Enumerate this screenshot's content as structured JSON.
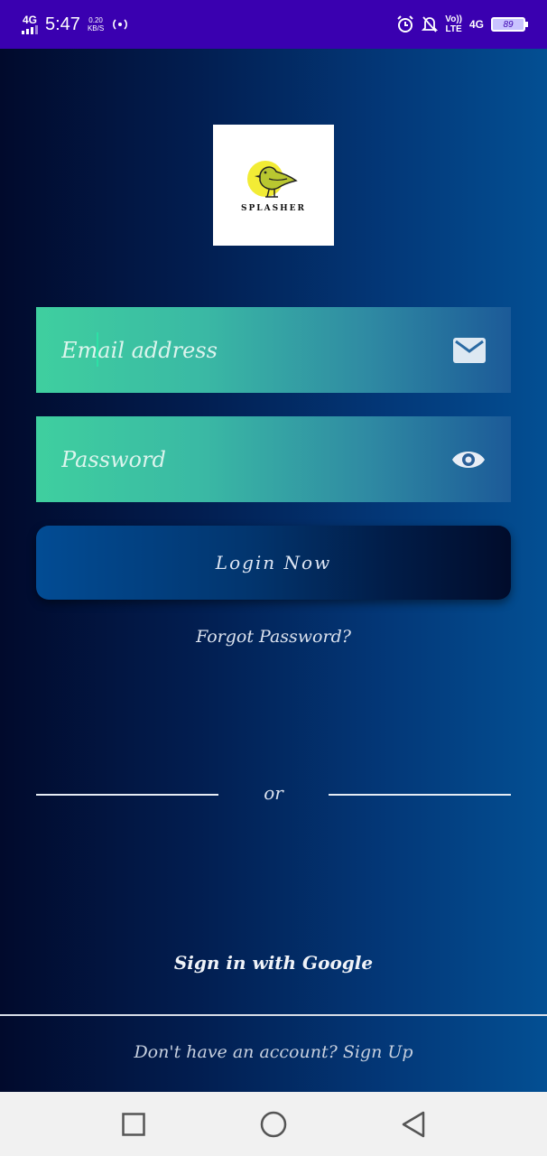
{
  "status_bar": {
    "network": "4G",
    "time": "5:47",
    "speed_value": "0.20",
    "speed_unit": "KB/S",
    "volte": "Vo))",
    "lte": "LTE",
    "network_right": "4G",
    "battery": "89",
    "colors": {
      "background": "#3a00b0"
    }
  },
  "logo": {
    "text": "SPLASHER",
    "icon": "bird-logo-icon"
  },
  "email_field": {
    "placeholder": "Email address",
    "icon": "envelope-icon"
  },
  "password_field": {
    "placeholder": "Password",
    "icon": "eye-icon"
  },
  "login_button": {
    "label": "Login Now"
  },
  "forgot_password": {
    "label": "Forgot Password?"
  },
  "divider": {
    "label": "or"
  },
  "google_signin": {
    "label": "Sign in with Google"
  },
  "signup": {
    "label": "Don't have an account? Sign Up"
  },
  "nav_bar": {
    "icons": [
      "recent-apps-icon",
      "home-icon",
      "back-icon"
    ]
  },
  "colors": {
    "field_gradient_start": "#3fcf9f",
    "field_gradient_end": "#1c5a98",
    "background_dark": "#010a2c",
    "background_light": "#034f93"
  }
}
